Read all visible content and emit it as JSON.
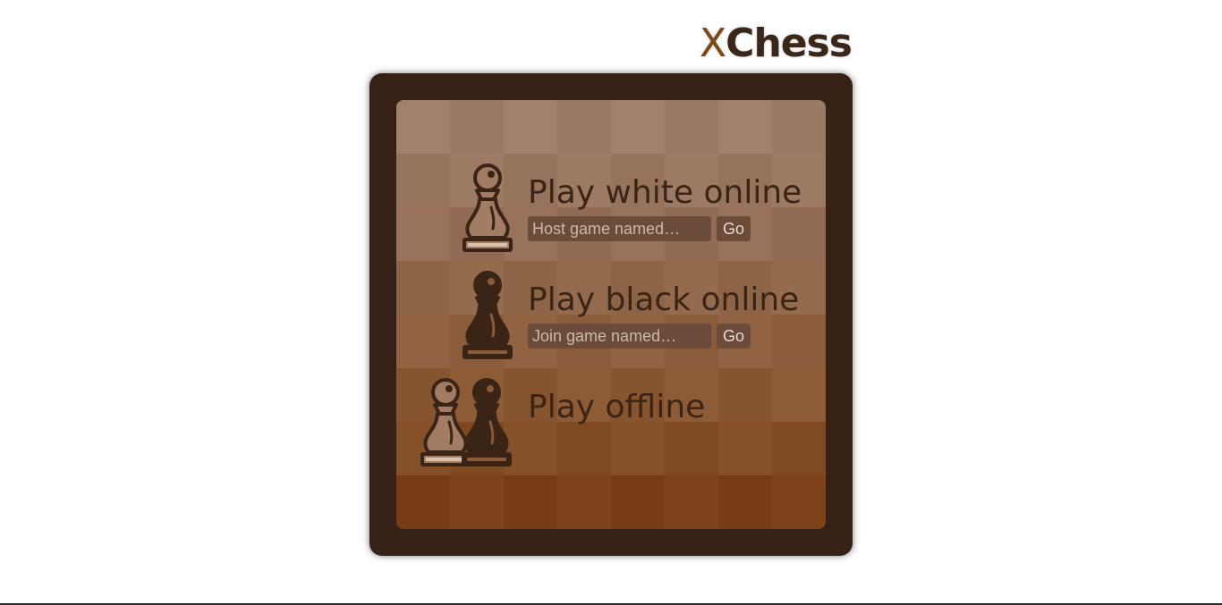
{
  "app": {
    "logo_prefix": "X",
    "logo_rest": "Chess"
  },
  "menu": {
    "white_online": {
      "title": "Play white online",
      "input_placeholder": "Host game named…",
      "go_label": "Go"
    },
    "black_online": {
      "title": "Play black online",
      "input_placeholder": "Join game named…",
      "go_label": "Go"
    },
    "offline": {
      "title": "Play offline"
    }
  },
  "icons": {
    "white_online": "white-pawn-icon",
    "black_online": "black-pawn-icon",
    "offline": "white-and-black-pawn-icon"
  },
  "colors": {
    "frame": "#352116",
    "text": "#3a2416",
    "accent": "#7a4718",
    "rank_base": [
      "#9c7e68",
      "#957059",
      "#8f6344",
      "#88552f",
      "#7b3f17"
    ]
  }
}
